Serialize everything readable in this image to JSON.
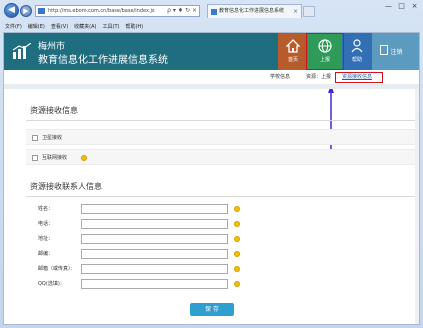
{
  "browser": {
    "address": "http://ms.ebom.com.cn/base/base/index.js",
    "address_tools": "ρ ▾ ♦ ↻ ×",
    "tab_title": "教育信息化工作进展信息系统",
    "menu": [
      "文件(F)",
      "编辑(E)",
      "查看(V)",
      "收藏夹(A)",
      "工具(T)",
      "帮助(H)"
    ],
    "window_controls": [
      "—",
      "□",
      "×"
    ]
  },
  "app": {
    "title_line1": "梅州市",
    "title_line2": "教育信息化工作进展信息系统",
    "nav": {
      "home": "首页",
      "online": "上报",
      "help": "帮助",
      "logout": "注销"
    },
    "subbar": {
      "item_a": "学校信息",
      "item_b": "资源：上报",
      "item_c": "资源接收信息"
    }
  },
  "resource_info": {
    "title": "资源接收信息",
    "checkbox_1": "卫星接收",
    "checkbox_2": "互联网接收"
  },
  "contact_info": {
    "title": "资源接收联系人信息",
    "fields": [
      {
        "label": "姓名：",
        "value": ""
      },
      {
        "label": "电话：",
        "value": ""
      },
      {
        "label": "地址：",
        "value": ""
      },
      {
        "label": "邮编：",
        "value": ""
      },
      {
        "label": "邮箱（或传真）：",
        "value": ""
      },
      {
        "label": "QQ(选填)：",
        "value": ""
      }
    ]
  },
  "save_label": "保 存",
  "colors": {
    "header": "#1f6e80",
    "home": "#b65b2c",
    "online": "#2f9b59",
    "help": "#326fb4",
    "logout": "#5b9bbf",
    "highlight": "#d3111c",
    "arrow": "#3a2bd8",
    "save": "#2f9fd0"
  }
}
